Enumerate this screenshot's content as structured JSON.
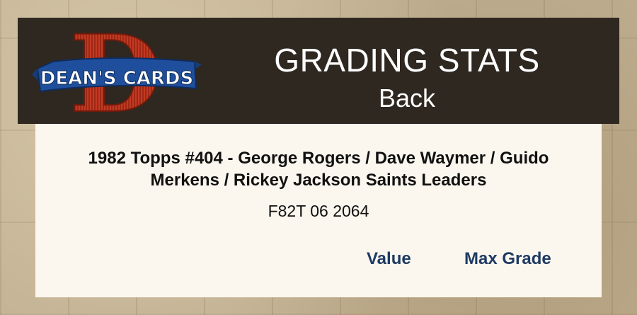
{
  "header": {
    "logo_text": "DEAN'S CARDS",
    "logo_letter": "D",
    "title": "GRADING STATS",
    "subtitle": "Back"
  },
  "card": {
    "title": "1982 Topps #404  -  George Rogers / Dave Waymer / Guido Merkens / Rickey Jackson Saints Leaders",
    "cert_number": "F82T 06 2064"
  },
  "columns": {
    "value_label": "Value",
    "max_grade_label": "Max Grade"
  },
  "colors": {
    "header_bg": "#2f2820",
    "panel_bg": "#fbf7ee",
    "column_text": "#1f3a64",
    "logo_red": "#b8321f",
    "logo_blue": "#1f4f9c"
  }
}
